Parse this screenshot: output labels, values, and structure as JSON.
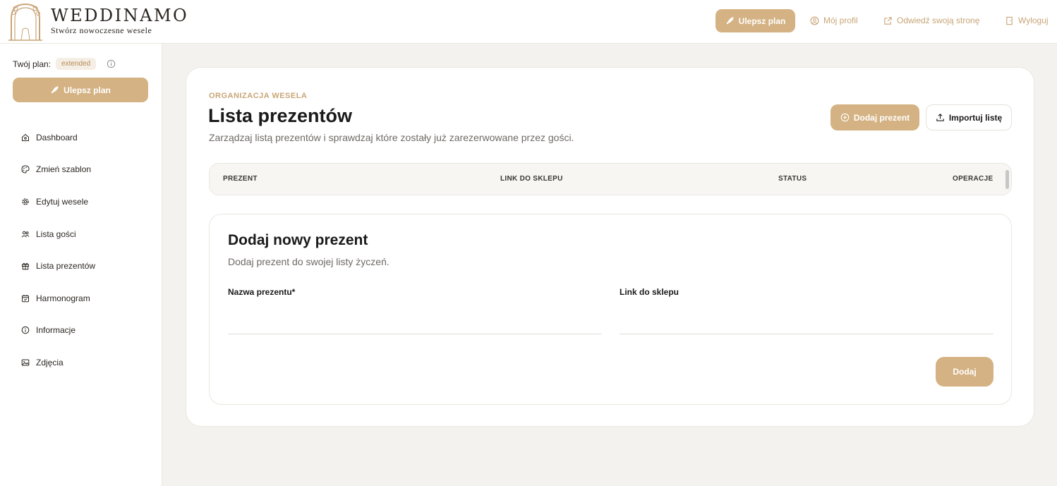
{
  "brand": {
    "name": "WEDDINAMO",
    "tagline": "Stwórz nowoczesne wesele"
  },
  "header": {
    "upgrade_label": "Ulepsz plan",
    "profile_label": "Mój profil",
    "visit_label": "Odwiedź swoją stronę",
    "logout_label": "Wyloguj"
  },
  "sidebar": {
    "plan_label": "Twój plan:",
    "plan_badge": "extended",
    "upgrade_label": "Ulepsz plan",
    "items": [
      {
        "label": "Dashboard",
        "icon": "dashboard-icon"
      },
      {
        "label": "Zmień szablon",
        "icon": "palette-icon"
      },
      {
        "label": "Edytuj wesele",
        "icon": "gear-icon"
      },
      {
        "label": "Lista gości",
        "icon": "users-icon"
      },
      {
        "label": "Lista prezentów",
        "icon": "gift-icon"
      },
      {
        "label": "Harmonogram",
        "icon": "calendar-icon"
      },
      {
        "label": "Informacje",
        "icon": "info-icon"
      },
      {
        "label": "Zdjęcia",
        "icon": "image-icon"
      }
    ]
  },
  "main": {
    "eyebrow": "ORGANIZACJA WESELA",
    "title": "Lista prezentów",
    "subtitle": "Zarządzaj listą prezentów i sprawdzaj które zostały już zarezerwowane przez gości.",
    "add_button": "Dodaj prezent",
    "import_button": "Importuj listę",
    "table": {
      "columns": [
        "PREZENT",
        "LINK DO SKLEPU",
        "STATUS",
        "OPERACJE"
      ]
    },
    "form": {
      "title": "Dodaj nowy prezent",
      "subtitle": "Dodaj prezent do swojej listy życzeń.",
      "name_label": "Nazwa prezentu*",
      "name_value": "",
      "link_label": "Link do sklepu",
      "link_value": "",
      "submit_label": "Dodaj"
    }
  },
  "colors": {
    "accent": "#d4b283",
    "accent_text": "#c8a577",
    "background": "#f4f2ee"
  }
}
